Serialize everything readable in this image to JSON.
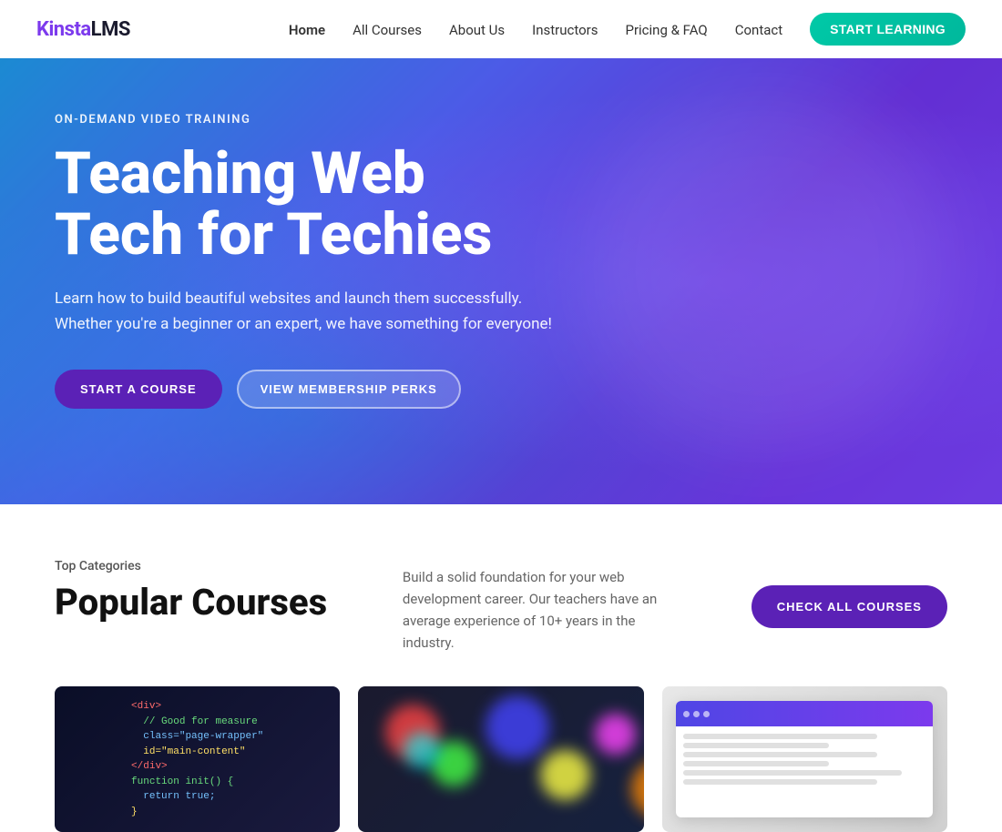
{
  "logo": {
    "kinsta": "Kinsta",
    "lms": "LMS"
  },
  "nav": {
    "links": [
      {
        "label": "Home",
        "active": true
      },
      {
        "label": "All Courses",
        "active": false
      },
      {
        "label": "About Us",
        "active": false
      },
      {
        "label": "Instructors",
        "active": false
      },
      {
        "label": "Pricing & FAQ",
        "active": false
      },
      {
        "label": "Contact",
        "active": false
      }
    ],
    "cta_label": "START LEARNING"
  },
  "hero": {
    "eyebrow": "ON-DEMAND VIDEO TRAINING",
    "title_line1": "Teaching Web",
    "title_line2": "Tech for Techies",
    "subtitle": "Learn how to build beautiful websites and launch them successfully. Whether you're a beginner or an expert, we have something for everyone!",
    "btn_start": "START A COURSE",
    "btn_membership": "VIEW MEMBERSHIP PERKS"
  },
  "courses": {
    "top_categories_label": "Top Categories",
    "title": "Popular Courses",
    "description": "Build a solid foundation for your web development career. Our teachers have an average experience of 10+ years in the industry.",
    "check_all_label": "CHECK ALL COURSES",
    "thumbnails": [
      {
        "type": "code",
        "alt": "Code tutorial thumbnail"
      },
      {
        "type": "bokeh",
        "alt": "Design bokeh thumbnail"
      },
      {
        "type": "design",
        "alt": "UI design thumbnail"
      }
    ]
  }
}
